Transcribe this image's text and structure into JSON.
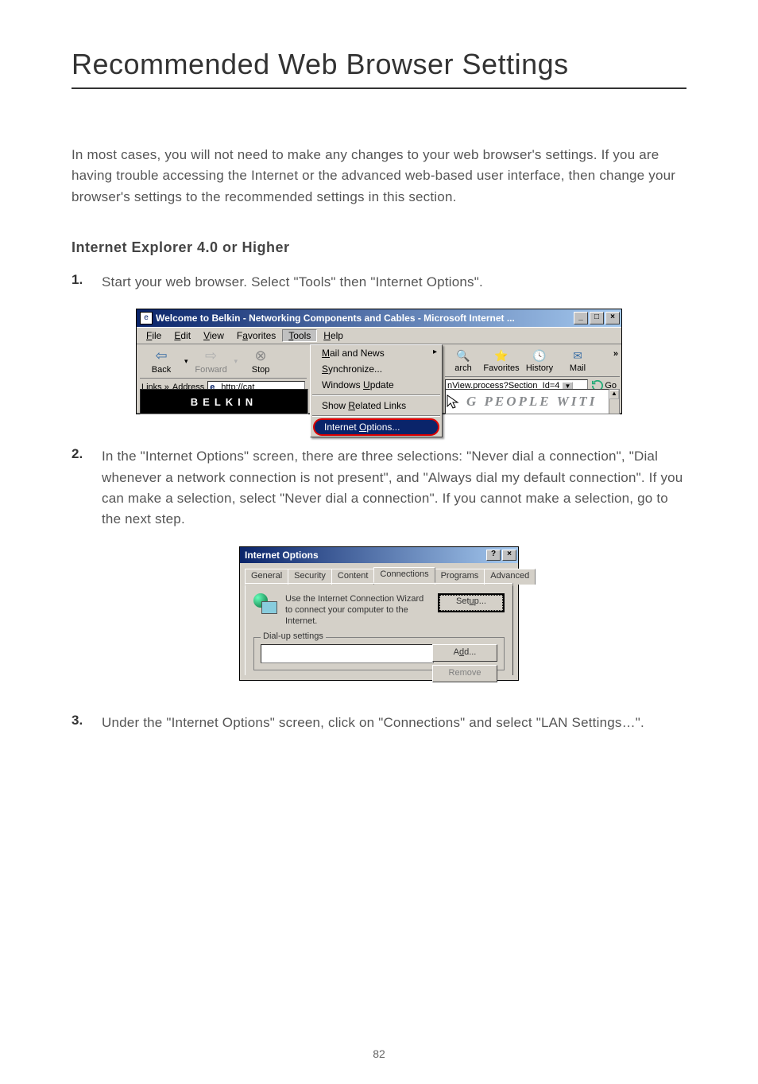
{
  "heading": "Recommended Web Browser Settings",
  "intro": "In most cases, you will not need to make any changes to your web browser's settings. If you are having trouble accessing the Internet or the advanced web-based user interface, then change your browser's settings to the recommended settings in this section.",
  "subhead": "Internet Explorer 4.0 or Higher",
  "steps": {
    "s1_num": "1.",
    "s1_text": "Start your web browser. Select \"Tools\" then \"Internet Options\".",
    "s2_num": "2.",
    "s2_text": "In the \"Internet Options\" screen, there are three selections: \"Never dial a connection\", \"Dial whenever a network connection is not present\", and \"Always dial my default connection\". If you can make a selection, select \"Never dial a connection\". If you cannot make a selection, go to the next step.",
    "s3_num": "3.",
    "s3_text": "Under the \"Internet Options\" screen, click on \"Connections\" and select \"LAN Settings…\"."
  },
  "ie_shot": {
    "title": "Welcome to Belkin - Networking Components and Cables - Microsoft Internet ...",
    "menus": {
      "file": "File",
      "edit": "Edit",
      "view": "View",
      "favorites": "Favorites",
      "tools": "Tools",
      "help": "Help"
    },
    "tb": {
      "back": "Back",
      "forward": "Forward",
      "stop": "Stop",
      "links": "Links »",
      "address_lbl": "Address",
      "address_val": "http://cat",
      "ie_glyph": "e"
    },
    "dropdown": {
      "mail": "Mail and News",
      "sync": "Synchronize...",
      "update": "Windows Update",
      "related": "Show Related Links",
      "options": "Internet Options..."
    },
    "right_tb": {
      "arch": "arch",
      "favorites": "Favorites",
      "history": "History",
      "mail": "Mail",
      "more": "»",
      "addr_right": "nView.process?Section_Id=4",
      "go": "Go"
    },
    "content_text": "G  PEOPLE  WITI",
    "belkin": "BELKIN"
  },
  "opt_shot": {
    "title": "Internet Options",
    "tabs": {
      "general": "General",
      "security": "Security",
      "content": "Content",
      "connections": "Connections",
      "programs": "Programs",
      "advanced": "Advanced"
    },
    "wizard_text": "Use the Internet Connection Wizard to connect your computer to the Internet.",
    "setup": "Setup...",
    "dialup_legend": "Dial-up settings",
    "add": "Add...",
    "remove": "Remove"
  },
  "page_number": "82"
}
